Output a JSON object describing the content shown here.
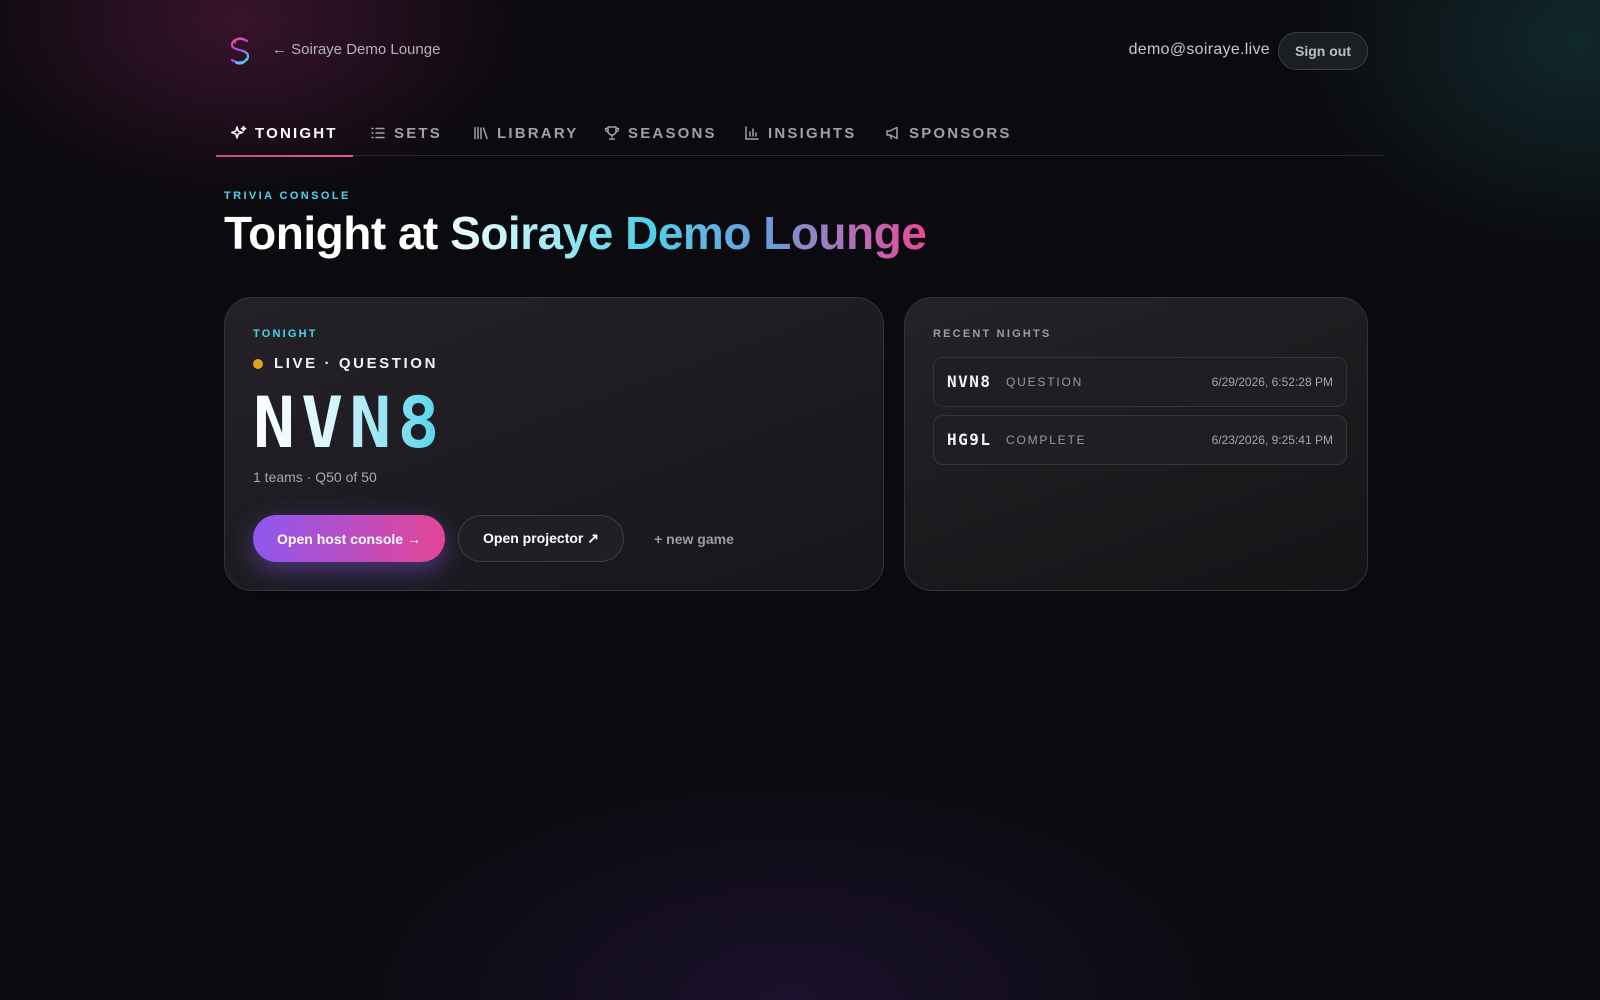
{
  "header": {
    "back_label": "← Soiraye Demo Lounge",
    "user_email": "demo@soiraye.live",
    "signout_label": "Sign out"
  },
  "nav": {
    "tabs": [
      {
        "label": "TONIGHT",
        "icon": "sparkles-icon",
        "active": true
      },
      {
        "label": "SETS",
        "icon": "list-icon",
        "active": false
      },
      {
        "label": "LIBRARY",
        "icon": "library-icon",
        "active": false
      },
      {
        "label": "SEASONS",
        "icon": "trophy-icon",
        "active": false
      },
      {
        "label": "INSIGHTS",
        "icon": "bar-chart-icon",
        "active": false
      },
      {
        "label": "SPONSORS",
        "icon": "megaphone-icon",
        "active": false
      }
    ]
  },
  "page": {
    "eyebrow": "TRIVIA CONSOLE",
    "title": "Tonight at Soiraye Demo Lounge"
  },
  "tonight": {
    "label": "TONIGHT",
    "status": "LIVE · QUESTION",
    "code": "NVN8",
    "meta": "1 teams · Q50 of 50",
    "host_button": "Open host console →",
    "projector_button": "Open projector ↗",
    "new_game_button": "+ new game"
  },
  "recent": {
    "label": "RECENT NIGHTS",
    "items": [
      {
        "code": "NVN8",
        "status": "QUESTION",
        "date": "6/29/2026, 6:52:28 PM"
      },
      {
        "code": "HG9L",
        "status": "COMPLETE",
        "date": "6/23/2026, 9:25:41 PM"
      }
    ]
  },
  "colors": {
    "accent_cyan": "#4fd5ea",
    "accent_pink": "#e44596",
    "accent_purple": "#8f57f0",
    "live_dot": "#e2a21d"
  }
}
